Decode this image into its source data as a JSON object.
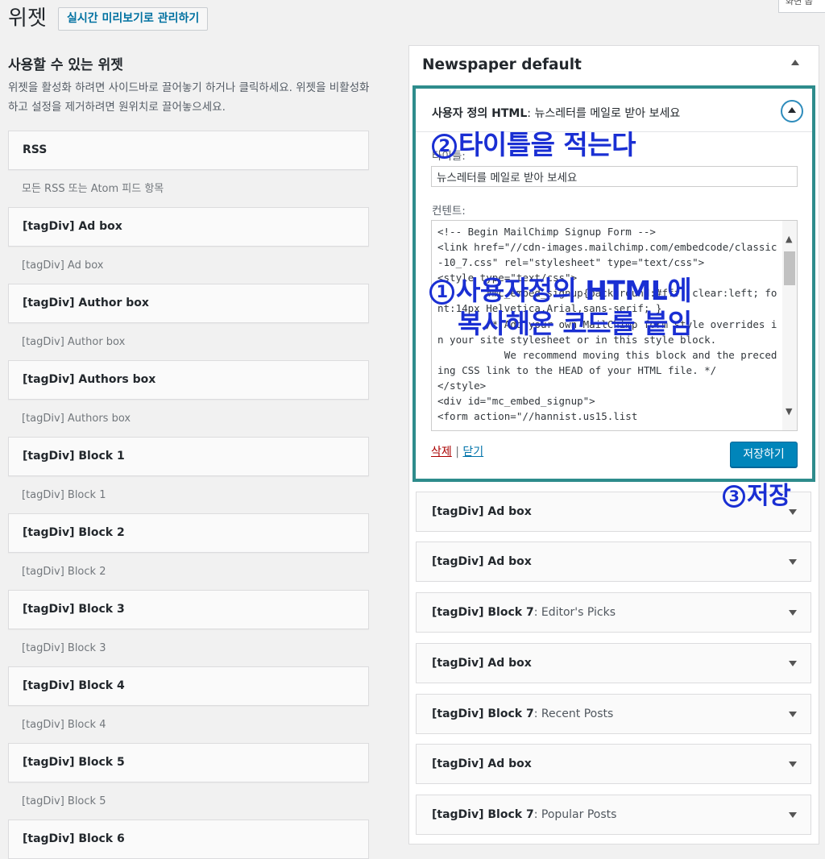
{
  "header": {
    "screen_options": "화면 옵",
    "page_title": "위젯",
    "live_preview_button": "실시간 미리보기로 관리하기"
  },
  "available": {
    "title": "사용할 수 있는 위젯",
    "description": "위젯을 활성화 하려면 사이드바로 끌어놓기 하거나 클릭하세요. 위젯을 비활성화 하고 설정을 제거하려면 원위치로 끌어놓으세요.",
    "widgets": [
      {
        "name": "RSS",
        "desc": "모든 RSS 또는 Atom 피드 항목"
      },
      {
        "name": "[tagDiv] Ad box",
        "desc": "[tagDiv] Ad box"
      },
      {
        "name": "[tagDiv] Author box",
        "desc": "[tagDiv] Author box"
      },
      {
        "name": "[tagDiv] Authors box",
        "desc": "[tagDiv] Authors box"
      },
      {
        "name": "[tagDiv] Block 1",
        "desc": "[tagDiv] Block 1"
      },
      {
        "name": "[tagDiv] Block 2",
        "desc": "[tagDiv] Block 2"
      },
      {
        "name": "[tagDiv] Block 3",
        "desc": "[tagDiv] Block 3"
      },
      {
        "name": "[tagDiv] Block 4",
        "desc": "[tagDiv] Block 4"
      },
      {
        "name": "[tagDiv] Block 5",
        "desc": "[tagDiv] Block 5"
      },
      {
        "name": "[tagDiv] Block 6",
        "desc": ""
      }
    ]
  },
  "sidebar": {
    "title": "Newspaper default",
    "open_widget": {
      "type_label": "사용자 정의 HTML",
      "title_suffix": ": 뉴스레터를 메일로 받아 보세요",
      "title_label": "타이틀:",
      "title_value": "뉴스레터를 메일로 받아 보세요",
      "content_label": "컨텐트:",
      "content_code": "<!-- Begin MailChimp Signup Form -->\n<link href=\"//cdn-images.mailchimp.com/embedcode/classic-10_7.css\" rel=\"stylesheet\" type=\"text/css\">\n<style type=\"text/css\">\n        #mc_embed_signup{background:#fff; clear:left; font:14px Helvetica,Arial,sans-serif; }\n        /* Add your own MailChimp form style overrides in your site stylesheet or in this style block.\n           We recommend moving this block and the preceding CSS link to the HEAD of your HTML file. */\n</style>\n<div id=\"mc_embed_signup\">\n<form action=\"//hannist.us15.list",
      "delete_link": "삭제",
      "separator": "|",
      "close_link": "닫기",
      "save_button": "저장하기"
    },
    "widgets": [
      {
        "type": "[tagDiv] Ad box",
        "sub": ""
      },
      {
        "type": "[tagDiv] Ad box",
        "sub": ""
      },
      {
        "type": "[tagDiv] Block 7",
        "sub": ": Editor's Picks"
      },
      {
        "type": "[tagDiv] Ad box",
        "sub": ""
      },
      {
        "type": "[tagDiv] Block 7",
        "sub": ": Recent Posts"
      },
      {
        "type": "[tagDiv] Ad box",
        "sub": ""
      },
      {
        "type": "[tagDiv] Block 7",
        "sub": ": Popular Posts"
      }
    ]
  },
  "annotations": {
    "step1_num": "1",
    "step1_line1": "사용자정의 HTML에",
    "step1_line2": "복사해온 코드를 붙임",
    "step2_num": "2",
    "step2_text": "타이틀을 적는다",
    "step3_num": "3",
    "step3_text": "저장"
  },
  "colors": {
    "annotation": "#1a2fd3",
    "highlight_border": "#2e8c8c",
    "primary_button": "#0085ba",
    "delete_link": "#aa0000"
  }
}
